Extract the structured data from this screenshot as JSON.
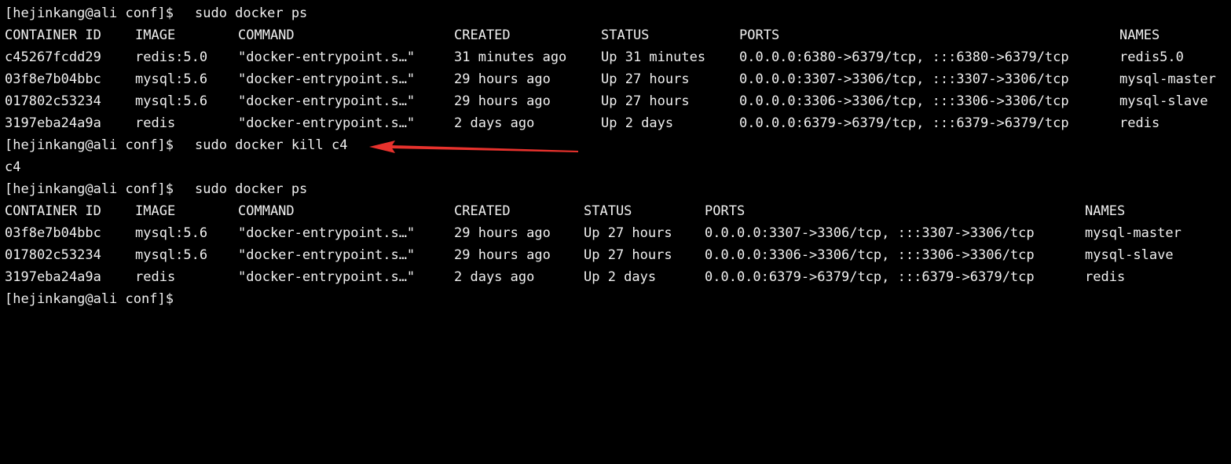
{
  "prompt": "[hejinkang@ali conf]$",
  "commands": {
    "ps_1": "sudo docker ps",
    "kill": "sudo docker kill c4",
    "kill_output": "c4",
    "ps_2": "sudo docker ps"
  },
  "headers": {
    "container_id": "CONTAINER ID",
    "image": "IMAGE",
    "command": "COMMAND",
    "created": "CREATED",
    "status": "STATUS",
    "ports": "PORTS",
    "names": "NAMES"
  },
  "table_1": [
    [
      "c45267fcdd29",
      "redis:5.0",
      "\"docker-entrypoint.s…\"",
      "31 minutes ago",
      "Up 31 minutes",
      "0.0.0.0:6380->6379/tcp, :::6380->6379/tcp",
      "redis5.0"
    ],
    [
      "03f8e7b04bbc",
      "mysql:5.6",
      "\"docker-entrypoint.s…\"",
      "29 hours ago",
      "Up 27 hours",
      "0.0.0.0:3307->3306/tcp, :::3307->3306/tcp",
      "mysql-master"
    ],
    [
      "017802c53234",
      "mysql:5.6",
      "\"docker-entrypoint.s…\"",
      "29 hours ago",
      "Up 27 hours",
      "0.0.0.0:3306->3306/tcp, :::3306->3306/tcp",
      "mysql-slave"
    ],
    [
      "3197eba24a9a",
      "redis",
      "\"docker-entrypoint.s…\"",
      "2 days ago",
      "Up 2 days",
      "0.0.0.0:6379->6379/tcp, :::6379->6379/tcp",
      "redis"
    ]
  ],
  "table_2": [
    [
      "03f8e7b04bbc",
      "mysql:5.6",
      "\"docker-entrypoint.s…\"",
      "29 hours ago",
      "Up 27 hours",
      "0.0.0.0:3307->3306/tcp, :::3307->3306/tcp",
      "mysql-master"
    ],
    [
      "017802c53234",
      "mysql:5.6",
      "\"docker-entrypoint.s…\"",
      "29 hours ago",
      "Up 27 hours",
      "0.0.0.0:3306->3306/tcp, :::3306->3306/tcp",
      "mysql-slave"
    ],
    [
      "3197eba24a9a",
      "redis",
      "\"docker-entrypoint.s…\"",
      "2 days ago",
      "Up 2 days",
      "0.0.0.0:6379->6379/tcp, :::6379->6379/tcp",
      "redis"
    ]
  ],
  "colors": {
    "background": "#000000",
    "text": "#f0f0f0",
    "annotation_arrow": "#e8322d"
  }
}
